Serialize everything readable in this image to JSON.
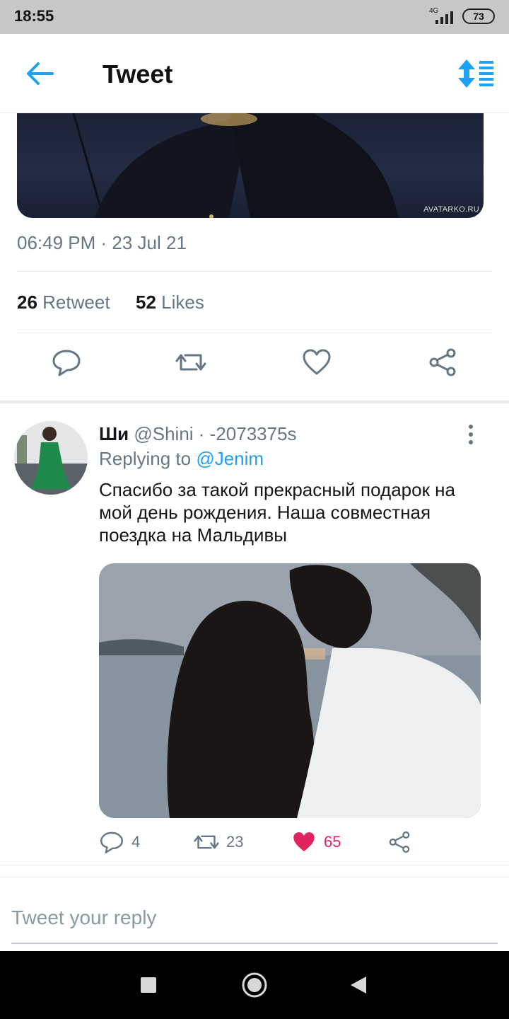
{
  "status_bar": {
    "time": "18:55",
    "network": "4G",
    "battery": "73"
  },
  "header": {
    "title": "Tweet"
  },
  "main_tweet": {
    "image_watermark": "AVATARKO.RU",
    "timestamp": "06:49 PM · 23 Jul 21",
    "retweet_count": "26",
    "retweet_label": "Retweet",
    "like_count": "52",
    "like_label": "Likes"
  },
  "reply": {
    "name": "Ши",
    "handle": "@Shini · -2073375s",
    "replying_label": "Replying to",
    "replying_to": "@Jenim",
    "text": "Спасибо за такой прекрасный подарок на мой день рождения. Наша совместная поездка на Мальдивы",
    "reply_count": "4",
    "retweet_count": "23",
    "like_count": "65"
  },
  "compose": {
    "placeholder": "Tweet your reply"
  },
  "colors": {
    "accent": "#1da1f2",
    "like": "#e0245e",
    "muted": "#657786"
  }
}
